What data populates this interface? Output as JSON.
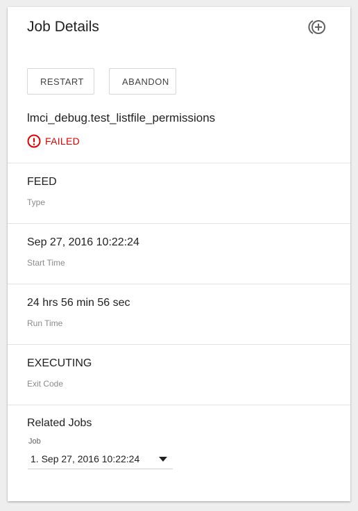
{
  "header": {
    "title": "Job Details",
    "action_icon": "add-circle-history-icon"
  },
  "actions": {
    "restart_label": "RESTART",
    "abandon_label": "ABANDON"
  },
  "job": {
    "name": "lmci_debug.test_listfile_permissions",
    "status": "FAILED",
    "status_icon": "error-circle-icon",
    "status_color": "#e00000"
  },
  "details": [
    {
      "value": "FEED",
      "label": "Type"
    },
    {
      "value": "Sep 27, 2016 10:22:24",
      "label": "Start Time"
    },
    {
      "value": "24 hrs 56 min 56 sec",
      "label": "Run Time"
    },
    {
      "value": "EXECUTING",
      "label": "Exit Code"
    }
  ],
  "related": {
    "title": "Related Jobs",
    "select_label": "Job",
    "selected": "1. Sep 27, 2016 10:22:24"
  }
}
